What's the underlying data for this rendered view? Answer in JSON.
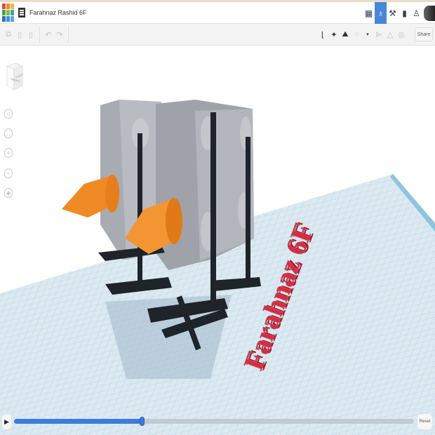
{
  "header": {
    "project_title": "Farahnaz Rashid 6F",
    "logo_letters": [
      "T",
      "I",
      "N",
      "K",
      "E",
      "R",
      "C",
      "A",
      "D"
    ],
    "logo_colors": [
      "#e9473a",
      "#f0892c",
      "#f3b33d",
      "#4aa84a",
      "#7cbf4c",
      "#3aa6a0",
      "#2f6fb7",
      "#3f8fd6",
      "#5aa3e0"
    ],
    "icons": [
      "grid-icon",
      "simulate-icon",
      "tools-icon",
      "bricks-icon",
      "user-add-icon"
    ],
    "active_icon": "simulate-icon"
  },
  "toolbar": {
    "left_icons": [
      "copy-icon",
      "paste-icon",
      "delete-icon",
      "undo-icon",
      "redo-icon"
    ],
    "right_icons": [
      "ruler-icon",
      "physics-icon",
      "notes-icon",
      "light-icon",
      "align-icon",
      "mirror-icon",
      "group-icon"
    ],
    "share_label": "Share"
  },
  "view": {
    "viewcube_front": "FRONT",
    "viewcube_right": "RIGHT",
    "nav_icons": [
      "home-icon",
      "fit-icon",
      "zoom-in-icon",
      "zoom-out-icon",
      "perspective-icon"
    ]
  },
  "scene": {
    "text_object": "Farahnaz 6F",
    "colors": {
      "grid": "#d6e6ee",
      "block": "#a9acb2",
      "stand": "#1e2229",
      "cone": "#f08a24",
      "text": "#e8243a"
    }
  },
  "playback": {
    "progress": 0.32,
    "reset_label": "Reset"
  }
}
